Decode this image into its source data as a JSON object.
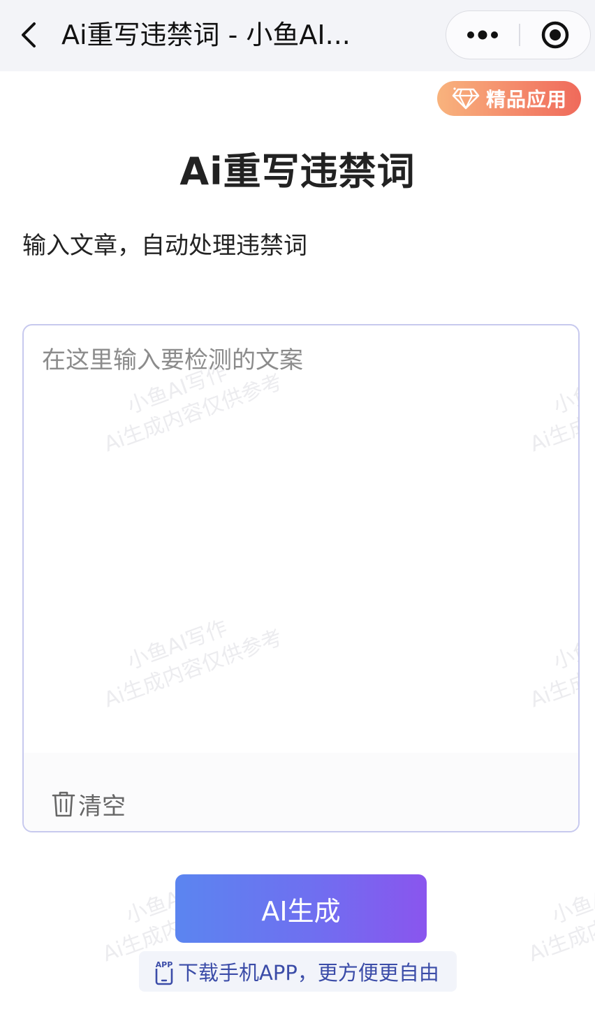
{
  "navbar": {
    "title": "Ai重写违禁词 - 小鱼AI...",
    "back_icon": "chevron-left-icon",
    "more_icon": "more-dots-icon",
    "close_icon": "target-circle-icon"
  },
  "badge": {
    "label": "精品应用",
    "icon": "diamond-icon",
    "color_start": "#f8b37d",
    "color_end": "#ef6a5b"
  },
  "main": {
    "title": "Ai重写违禁词",
    "subtitle": "输入文章，自动处理违禁词"
  },
  "editor": {
    "placeholder": "在这里输入要检测的文案",
    "value": "",
    "clear_label": "清空",
    "clear_icon": "trash-icon",
    "border_color": "#c7c9ee"
  },
  "watermark": {
    "line1": "小鱼AI写作",
    "line2": "Ai生成内容仅供参考"
  },
  "actions": {
    "generate_label": "AI生成",
    "download_label": "下载手机APP，更方便更自由",
    "download_icon": "phone-app-icon",
    "download_icon_text": "APP",
    "generate_color_start": "#5b85f0",
    "generate_color_end": "#8a55ee"
  }
}
